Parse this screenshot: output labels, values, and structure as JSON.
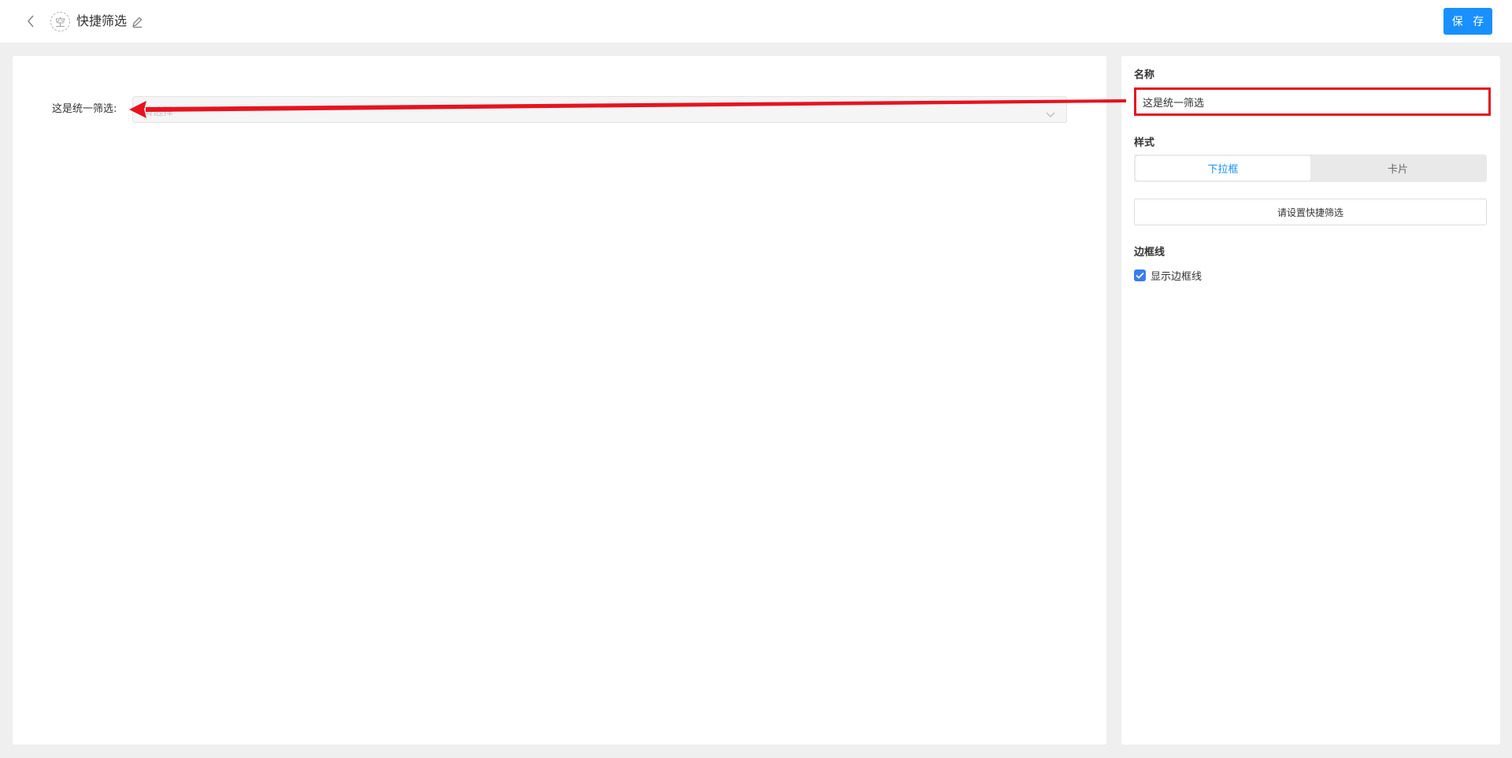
{
  "header": {
    "badge_text": "空",
    "title": "快捷筛选",
    "save_label": "保 存"
  },
  "canvas": {
    "filter_label": "这是统一筛选:",
    "filter_placeholder": "请选择"
  },
  "panel": {
    "name_title": "名称",
    "name_value": "这是统一筛选",
    "style_title": "样式",
    "style_options": [
      {
        "label": "下拉框",
        "active": true
      },
      {
        "label": "卡片",
        "active": false
      }
    ],
    "config_button": "请设置快捷筛选",
    "border_title": "边框线",
    "show_border_label": "显示边框线",
    "show_border_checked": true
  },
  "annotation": {
    "color": "#e8121f"
  },
  "colors": {
    "accent": "#1890ff",
    "checkbox": "#3b7cf2",
    "highlight": "#e8121f"
  }
}
